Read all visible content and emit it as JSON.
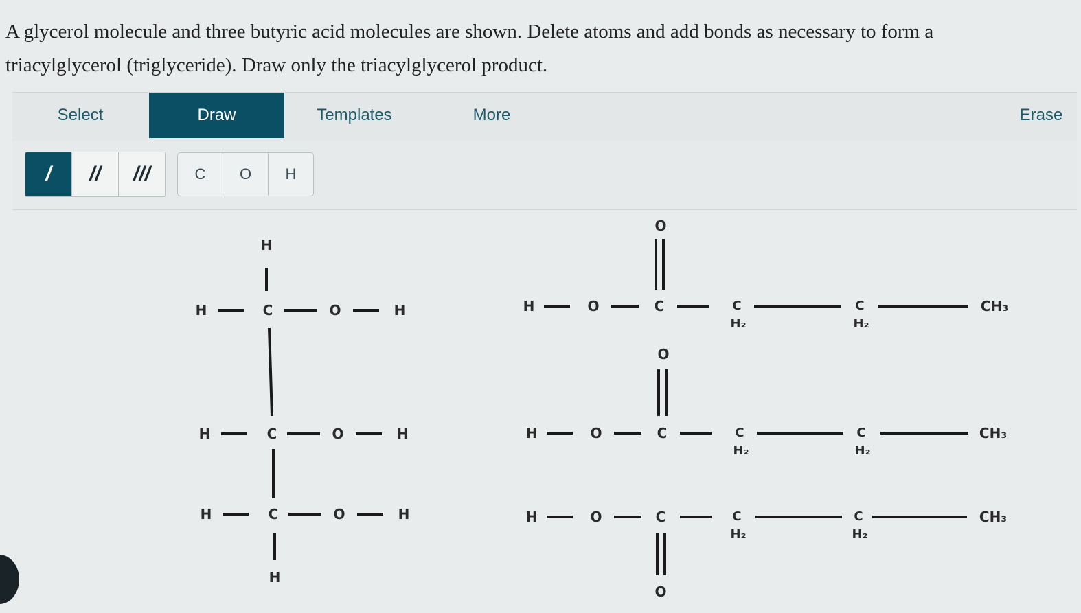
{
  "question": {
    "line1": "A glycerol molecule and three butyric acid molecules are shown. Delete atoms and add bonds as necessary to form a",
    "line2": "triacylglycerol (triglyceride). Draw only the triacylglycerol product."
  },
  "toolbar": {
    "select_label": "Select",
    "draw_label": "Draw",
    "templates_label": "Templates",
    "more_label": "More",
    "erase_label": "Erase",
    "active_tab": "Draw"
  },
  "bond_tools": {
    "single_label": "/",
    "double_label": "//",
    "triple_label": "///",
    "active": "single"
  },
  "atom_tools": {
    "carbon_label": "C",
    "oxygen_label": "O",
    "hydrogen_label": "H"
  },
  "atoms": {
    "H": "H",
    "C": "C",
    "O": "O",
    "H2": "H₂",
    "CH3": "CH₃"
  },
  "colors": {
    "active_bg": "#0b4f64",
    "tab_text": "#1e5a6a",
    "background": "#e9ecec"
  }
}
